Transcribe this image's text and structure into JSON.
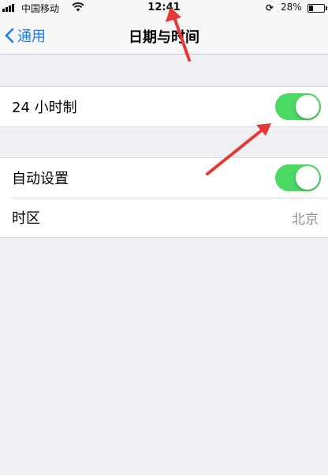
{
  "status_bar": {
    "carrier": "中国移动",
    "time": "12:41",
    "battery": "28%",
    "battery_level": 0.28
  },
  "nav": {
    "back_label": "通用",
    "title": "日期与时间"
  },
  "settings": {
    "hour24": {
      "label": "24 小时制",
      "on": true
    },
    "auto_set": {
      "label": "自动设置",
      "on": true
    },
    "timezone": {
      "label": "时区",
      "value": "北京"
    }
  },
  "colors": {
    "accent": "#1a7bf5",
    "toggle_on": "#4cd964",
    "annotation_arrow": "#e53935"
  }
}
